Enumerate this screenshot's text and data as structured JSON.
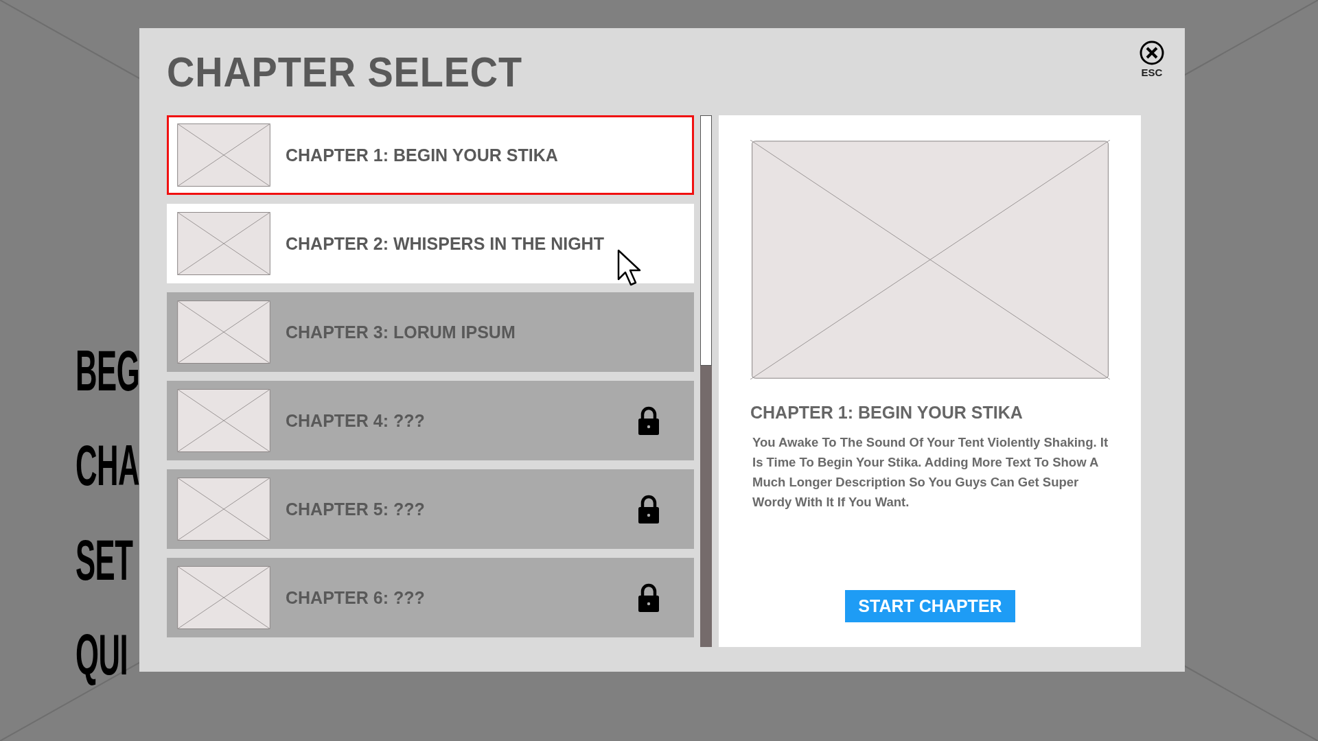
{
  "background_menu": [
    "BEG",
    "CHA",
    "SET",
    "QUI"
  ],
  "dialog": {
    "title": "CHAPTER SELECT",
    "close_label": "ESC",
    "chapters": [
      {
        "title": "CHAPTER 1: BEGIN YOUR STIKA",
        "selected": true,
        "available": true,
        "locked": false
      },
      {
        "title": "CHAPTER 2: WHISPERS IN THE NIGHT",
        "selected": false,
        "available": true,
        "locked": false
      },
      {
        "title": "CHAPTER 3: LORUM IPSUM",
        "selected": false,
        "available": false,
        "locked": false
      },
      {
        "title": "CHAPTER 4: ???",
        "selected": false,
        "available": false,
        "locked": true
      },
      {
        "title": "CHAPTER 5: ???",
        "selected": false,
        "available": false,
        "locked": true
      },
      {
        "title": "CHAPTER 6: ???",
        "selected": false,
        "available": false,
        "locked": true
      }
    ],
    "detail": {
      "title": "CHAPTER 1: BEGIN YOUR STIKA",
      "description": "You Awake To The Sound Of Your Tent Violently Shaking. It Is Time To Begin Your Stika. Adding More Text To Show A Much Longer Description So You Guys Can Get Super Wordy With It If You Want.",
      "button": "START CHAPTER"
    }
  }
}
